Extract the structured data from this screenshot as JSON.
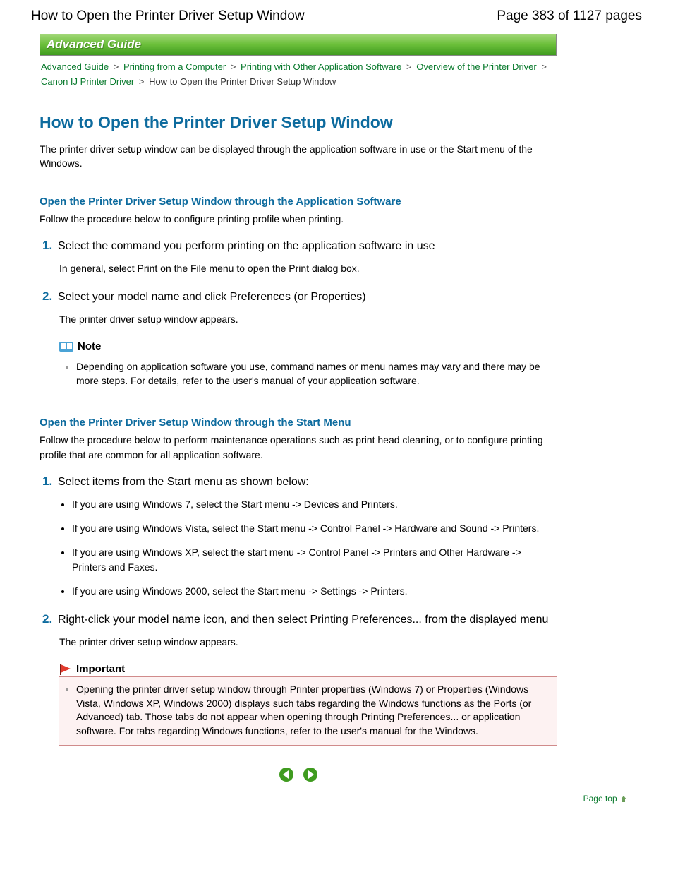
{
  "header": {
    "title": "How to Open the Printer Driver Setup Window",
    "page_indicator": "Page 383 of 1127 pages"
  },
  "banner": "Advanced Guide",
  "breadcrumbs": {
    "items": [
      {
        "label": "Advanced Guide",
        "link": true
      },
      {
        "label": "Printing from a Computer",
        "link": true
      },
      {
        "label": "Printing with Other Application Software",
        "link": true
      },
      {
        "label": "Overview of the Printer Driver",
        "link": true
      },
      {
        "label": "Canon IJ Printer Driver",
        "link": true
      },
      {
        "label": "How to Open the Printer Driver Setup Window",
        "link": false
      }
    ],
    "sep": ">"
  },
  "main_title": "How to Open the Printer Driver Setup Window",
  "intro": "The printer driver setup window can be displayed through the application software in use or the Start menu of the Windows.",
  "section1": {
    "heading": "Open the Printer Driver Setup Window through the Application Software",
    "desc": "Follow the procedure below to configure printing profile when printing.",
    "steps": [
      {
        "num": "1.",
        "title": "Select the command you perform printing on the application software in use",
        "body": "In general, select Print on the File menu to open the Print dialog box."
      },
      {
        "num": "2.",
        "title": "Select your model name and click Preferences (or Properties)",
        "body": "The printer driver setup window appears."
      }
    ],
    "note": {
      "label": "Note",
      "text": "Depending on application software you use, command names or menu names may vary and there may be more steps. For details, refer to the user's manual of your application software."
    }
  },
  "section2": {
    "heading": "Open the Printer Driver Setup Window through the Start Menu",
    "desc": "Follow the procedure below to perform maintenance operations such as print head cleaning, or to configure printing profile that are common for all application software.",
    "steps": [
      {
        "num": "1.",
        "title": "Select items from the Start menu as shown below:",
        "bullets": [
          "If you are using Windows 7, select the Start menu -> Devices and Printers.",
          "If you are using Windows Vista, select the Start menu -> Control Panel -> Hardware and Sound -> Printers.",
          "If you are using Windows XP, select the start menu -> Control Panel -> Printers and Other Hardware -> Printers and Faxes.",
          "If you are using Windows 2000, select the Start menu -> Settings -> Printers."
        ]
      },
      {
        "num": "2.",
        "title": "Right-click your model name icon, and then select Printing Preferences... from the displayed menu",
        "body": "The printer driver setup window appears."
      }
    ],
    "important": {
      "label": "Important",
      "text": "Opening the printer driver setup window through Printer properties (Windows 7) or Properties (Windows Vista, Windows XP, Windows 2000) displays such tabs regarding the Windows functions as the Ports (or Advanced) tab. Those tabs do not appear when opening through Printing Preferences... or application software. For tabs regarding Windows functions, refer to the user's manual for the Windows."
    }
  },
  "page_top": "Page top"
}
